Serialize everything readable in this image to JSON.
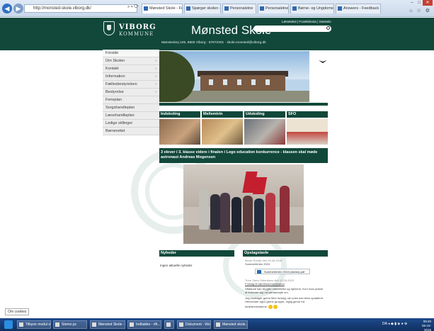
{
  "browser": {
    "url": "http://monsted-skole.viborg.dk/",
    "tabs": [
      {
        "label": "Mønsted Skole - Forside",
        "active": true
      },
      {
        "label": "Spørger skolen - Nyt fra...",
        "active": false
      },
      {
        "label": "Personaletne",
        "active": false
      },
      {
        "label": "Personaletne",
        "active": false
      },
      {
        "label": "Børne- og Ungdomsudvalget...",
        "active": false
      },
      {
        "label": "Answers - Feedback etterslagning...",
        "active": false
      }
    ],
    "window_controls": {
      "minimize": "–",
      "maximize": "□",
      "close": "✕"
    },
    "right_tools": "⌂ ☆ ⚙"
  },
  "site": {
    "kommune_line1": "VIBORG",
    "kommune_line2": "KOMMUNE",
    "school_name": "Mønsted Skole",
    "top_links": "Læsetekst  |  Forældrenta  |  Gæstelo",
    "address": "Mønstedvej 106, 8800 Viborg  ·  87872301  ·  skole.monsted@viborg.dk",
    "search_placeholder": ""
  },
  "sidebar": {
    "items": [
      {
        "label": "Forside",
        "arrow": false
      },
      {
        "label": "Om Skolen",
        "arrow": true
      },
      {
        "label": "Kontakt",
        "arrow": true
      },
      {
        "label": "Information",
        "arrow": true
      },
      {
        "label": "Fællesbestyrelsen",
        "arrow": true
      },
      {
        "label": "Bestyrelse",
        "arrow": true
      },
      {
        "label": "Ferieplan",
        "arrow": false
      },
      {
        "label": "Sorgshandleplan",
        "arrow": false
      },
      {
        "label": "Læsehandleplan",
        "arrow": false
      },
      {
        "label": "Ledige stillinger",
        "arrow": false
      },
      {
        "label": "Børnerettet",
        "arrow": false
      }
    ]
  },
  "cards": [
    {
      "title": "Indskoling"
    },
    {
      "title": "Mellemtrin"
    },
    {
      "title": "Udskoling"
    },
    {
      "title": "SFO"
    }
  ],
  "headline": "3 elever i 3. klasse videre i finalen i Lego education konkurrence - klassen skal møde astronaut Andreas Mogensen",
  "news": {
    "title": "Nyheder",
    "empty_text": "Ingen aktuelle nyheder"
  },
  "board": {
    "title": "Opslagstavle",
    "posts": [
      {
        "meta": "Bente Rohde den 26.08.2015",
        "text": "Sommerferien 2015"
      },
      {
        "file": "Sommerferien 2015 (skema).pdf"
      },
      {
        "meta": "Trine Slavo Dideriksen den 12.06.2015",
        "text": "Forslag til børnekommunikation"
      },
      {
        "body": "Sådanne kan bruges i skoletiden og hjemme, hvor man prøver at forbedre sig i at samarbejde om."
      },
      {
        "body": "Jeg modtager gerne flere forslag, så vores kan blive opdateret. Henvender egn/i gerne grupper, vigtig gerne fra"
      },
      {
        "body": "forældremøderne"
      }
    ]
  },
  "status_text": "Om cookies",
  "taskbar": {
    "items": [
      "Tilbyne modul og...",
      "Stemo.pc",
      "Mønsted Skole - P...",
      "Indbakke - rifr...",
      "",
      "Dokument - Word",
      "Mønsted skole..."
    ],
    "tray": "DA  ◂ ◆ ▮ ◈ ● ⊕",
    "time": "09:40",
    "date": "05-10-2015"
  }
}
